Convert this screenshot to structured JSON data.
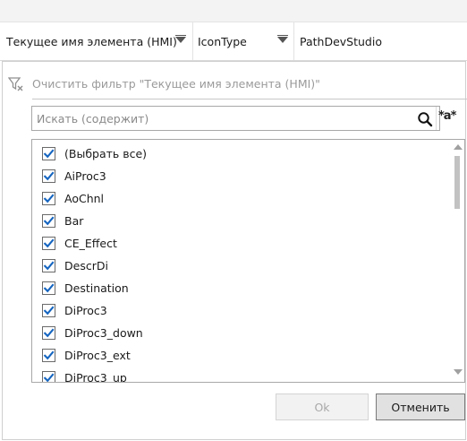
{
  "header": {
    "columns": [
      {
        "label": "Текущее имя элемента (HMI)",
        "sort_icon": "filter-dropdown-icon"
      },
      {
        "label": "IconType",
        "sort_icon": "filter-dropdown-icon"
      },
      {
        "label": "PathDevStudio"
      }
    ]
  },
  "filter_popup": {
    "clear_filter_label": "Очистить фильтр \"Текущее имя элемента (HMI)\"",
    "clear_filter_enabled": false,
    "search": {
      "placeholder": "Искать (содержит)",
      "value": "",
      "search_icon": "search-icon",
      "regex_toggle": "*a*"
    },
    "items": [
      {
        "label": "(Выбрать все)",
        "checked": true
      },
      {
        "label": "AiProc3",
        "checked": true
      },
      {
        "label": "AoChnl",
        "checked": true
      },
      {
        "label": "Bar",
        "checked": true
      },
      {
        "label": "CE_Effect",
        "checked": true
      },
      {
        "label": "DescrDi",
        "checked": true
      },
      {
        "label": "Destination",
        "checked": true
      },
      {
        "label": "DiProc3",
        "checked": true
      },
      {
        "label": "DiProc3_down",
        "checked": true
      },
      {
        "label": "DiProc3_ext",
        "checked": true
      },
      {
        "label": "DiProc3_up",
        "checked": true
      }
    ],
    "ok_label": "Ok",
    "ok_enabled": false,
    "cancel_label": "Отменить"
  },
  "colors": {
    "checkmark": "#1565c0",
    "disabled_text": "#a8a8a8",
    "border": "#a8a8a8"
  }
}
